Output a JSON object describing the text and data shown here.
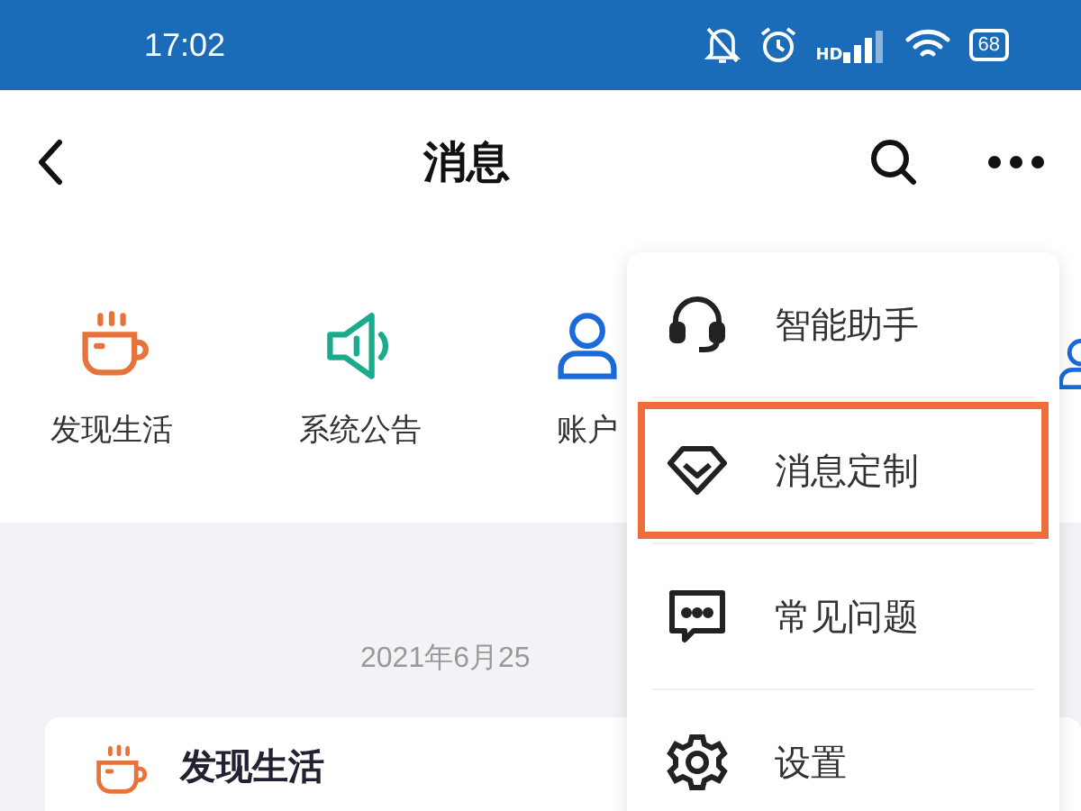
{
  "status_bar": {
    "time": "17:02",
    "network_label": "HD",
    "battery": "68"
  },
  "header": {
    "title": "消息"
  },
  "categories": [
    {
      "kind": "cup",
      "label": "发现生活"
    },
    {
      "kind": "speaker",
      "label": "系统公告"
    },
    {
      "kind": "person",
      "label": "账户"
    }
  ],
  "date": "2021年6月25",
  "card": {
    "kind": "cup",
    "title": "发现生活"
  },
  "menu": [
    {
      "kind": "headset",
      "label": "智能助手",
      "highlighted": false
    },
    {
      "kind": "diamond",
      "label": "消息定制",
      "highlighted": true
    },
    {
      "kind": "chat",
      "label": "常见问题",
      "highlighted": false
    },
    {
      "kind": "gear",
      "label": "设置",
      "highlighted": false
    }
  ]
}
